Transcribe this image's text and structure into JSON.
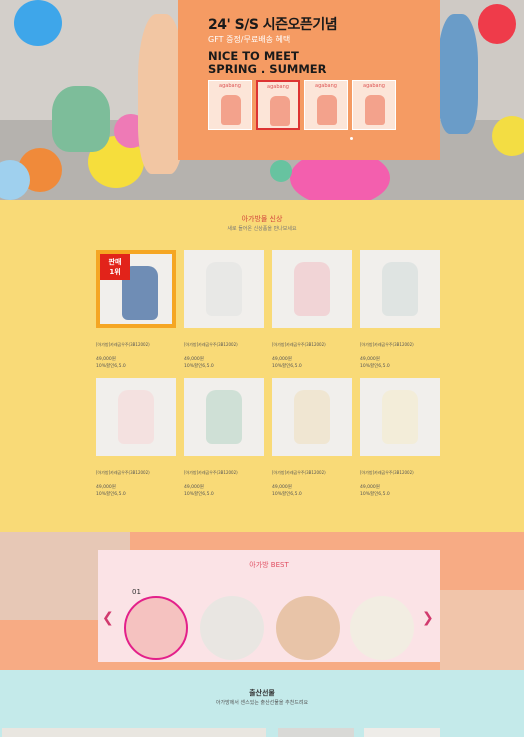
{
  "hero": {
    "title": "24' S/S 시즌오픈기념",
    "gift": "GFT 증정/무료배송 혜택",
    "headline": "NICE TO MEET\nSPRING . SUMMER",
    "thumb_brand": "agabang",
    "thumb_count": 4,
    "active_thumb": 2,
    "colors": {
      "panel": "#f59b63",
      "active_border": "#dd3333"
    }
  },
  "new_products": {
    "title": "아가방몰 신상",
    "subtitle": "새로 들어온 신상품을 만나보세요",
    "badge": "판매\n1위",
    "items": [
      {
        "name": "[아가방]카레곰우주(3B12002)",
        "price": "49,000원",
        "installment": "10%할인6,5.0",
        "color": "#6f8db5"
      },
      {
        "name": "[아가방]카레곰우주(3B12002)",
        "price": "49,000원",
        "installment": "10%할인6,5.0",
        "color": "#e8e8e6"
      },
      {
        "name": "[아가방]카레곰우주(3B12002)",
        "price": "49,000원",
        "installment": "10%할인6,5.0",
        "color": "#f1d4d6"
      },
      {
        "name": "[아가방]카레곰우주(3B12002)",
        "price": "49,000원",
        "installment": "10%할인6,5.0",
        "color": "#dfe4e2"
      },
      {
        "name": "[아가방]카레곰우주(3B12002)",
        "price": "49,000원",
        "installment": "10%할인6,5.0",
        "color": "#f4e1e0"
      },
      {
        "name": "[아가방]카레곰우주(3B12002)",
        "price": "49,000원",
        "installment": "10%할인6,5.0",
        "color": "#cfe0d6"
      },
      {
        "name": "[아가방]카레곰우주(3B12002)",
        "price": "49,000원",
        "installment": "10%할인6,5.0",
        "color": "#f0e6d2"
      },
      {
        "name": "[아가방]카레곰우주(3B12002)",
        "price": "49,000원",
        "installment": "10%할인6,5.0",
        "color": "#f3edd9"
      }
    ]
  },
  "best": {
    "title": "아가방 BEST",
    "rank": "01",
    "prev_arrow": "❮",
    "next_arrow": "❯",
    "items": [
      {
        "color": "#f5c2c0"
      },
      {
        "color": "#e9e6e2"
      },
      {
        "color": "#e8c4a8"
      },
      {
        "color": "#f2ede2"
      }
    ]
  },
  "gift": {
    "title": "출산선물",
    "subtitle": "아가방에서 센스있는 출산선물을 추천드려요"
  }
}
